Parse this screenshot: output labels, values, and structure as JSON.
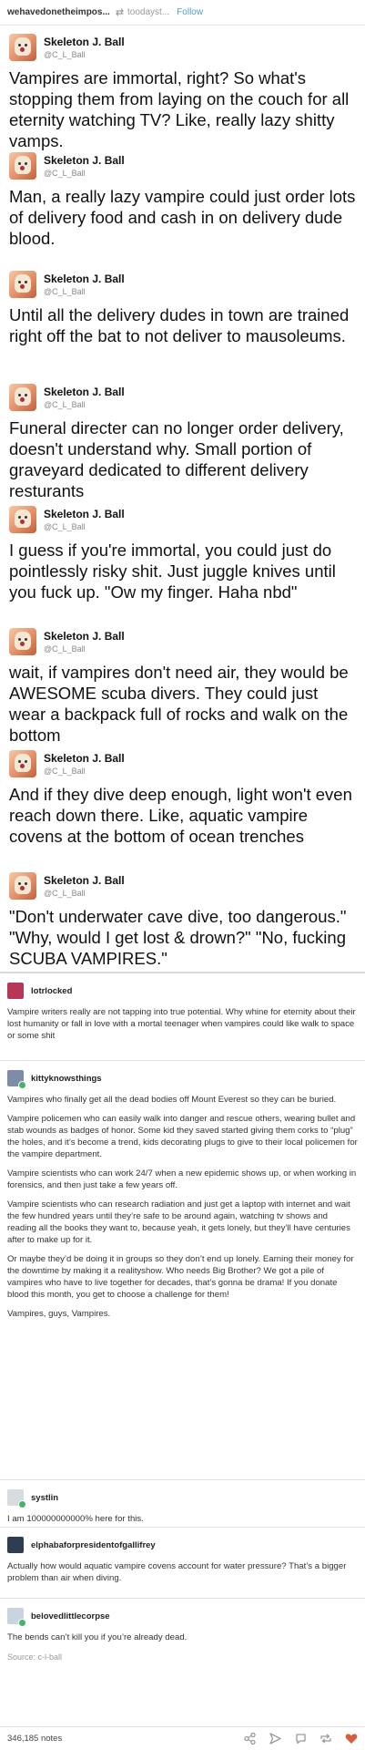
{
  "header": {
    "username": "wehavedonetheimpos...",
    "reblog_glyph": "⇄",
    "source": "toodayst...",
    "follow_label": "Follow"
  },
  "tweets": [
    {
      "name": "Skeleton J. Ball",
      "handle": "@C_L_Ball",
      "text": "Vampires are immortal, right? So what's stopping them from laying on the couch for all eternity watching TV? Like, really lazy shitty vamps."
    },
    {
      "name": "Skeleton J. Ball",
      "handle": "@C_L_Ball",
      "text": "Man, a really lazy vampire could just order lots of delivery food and cash in on delivery dude blood."
    },
    {
      "name": "Skeleton J. Ball",
      "handle": "@C_L_Ball",
      "text": "Until all the delivery dudes in town are trained right off the bat to not deliver to mausoleums."
    },
    {
      "name": "Skeleton J. Ball",
      "handle": "@C_L_Ball",
      "text": "Funeral directer can no longer order delivery, doesn't understand why. Small portion of graveyard dedicated to different delivery resturants"
    },
    {
      "name": "Skeleton J. Ball",
      "handle": "@C_L_Ball",
      "text": "I guess if you're immortal, you could just do pointlessly risky shit. Just juggle knives until you fuck up. \"Ow my finger. Haha nbd\""
    },
    {
      "name": "Skeleton J. Ball",
      "handle": "@C_L_Ball",
      "text": "wait, if vampires don't need air, they would be AWESOME scuba divers. They could just wear a backpack full of rocks and walk on the bottom"
    },
    {
      "name": "Skeleton J. Ball",
      "handle": "@C_L_Ball",
      "text": "And if they dive deep enough, light won't even reach down there. Like, aquatic vampire covens at the bottom of ocean trenches"
    },
    {
      "name": "Skeleton J. Ball",
      "handle": "@C_L_Ball",
      "text": "\"Don't underwater cave dive, too dangerous.\" \"Why, would I get lost & drown?\" \"No, fucking SCUBA VAMPIRES.\""
    }
  ],
  "reblogs": [
    {
      "user": "lotrlocked",
      "paragraphs": [
        "Vampire writers really are not tapping into true potential. Why whine for eternity about their lost humanity or fall in love with a mortal teenager when vampires could like walk to space or some shit"
      ]
    },
    {
      "user": "kittyknowsthings",
      "paragraphs": [
        "Vampires who finally get all the dead bodies off Mount Everest so they can be buried.",
        "Vampire policemen who can easily walk into danger and rescue others, wearing bullet and stab wounds as badges of honor. Some kid they saved started giving them corks to “plug” the holes, and it’s become a trend, kids decorating plugs to give to their local policemen for the vampire department.",
        "Vampire scientists who can work 24/7 when a new epidemic shows up, or when working in forensics, and then just take a few years off.",
        "Vampire scientists who can research radiation and just get a laptop with internet and wait the few hundred years until they’re safe to be around again, watching tv shows and reading all the books they want to, because yeah, it gets lonely, but they’ll have centuries after to make up for it.",
        "Or maybe they’d be doing it in groups so they don’t end up lonely. Earning their money for the downtime by making it a realityshow. Who needs Big Brother? We got a pile of vampires who have to live together for decades, that’s gonna be drama! If you donate blood this month, you get to choose a challenge for them!",
        "Vampires, guys, Vampires."
      ]
    },
    {
      "user": "systlin",
      "paragraphs": [
        "I am 100000000000% here for this."
      ]
    },
    {
      "user": "elphabaforpresidentofgallifrey",
      "paragraphs": [
        "Actually how would aquatic vampire covens account for water pressure? That’s a bigger problem than air when diving."
      ]
    },
    {
      "user": "belovedlittlecorpse",
      "paragraphs": [
        "The bends can’t kill you if you’re already dead."
      ]
    }
  ],
  "source_line": "Source: c-l-ball",
  "footer": {
    "notes": "346,185 notes",
    "icons": [
      "share-icon",
      "send-icon",
      "reply-icon",
      "reblog-icon",
      "like-icon"
    ]
  }
}
